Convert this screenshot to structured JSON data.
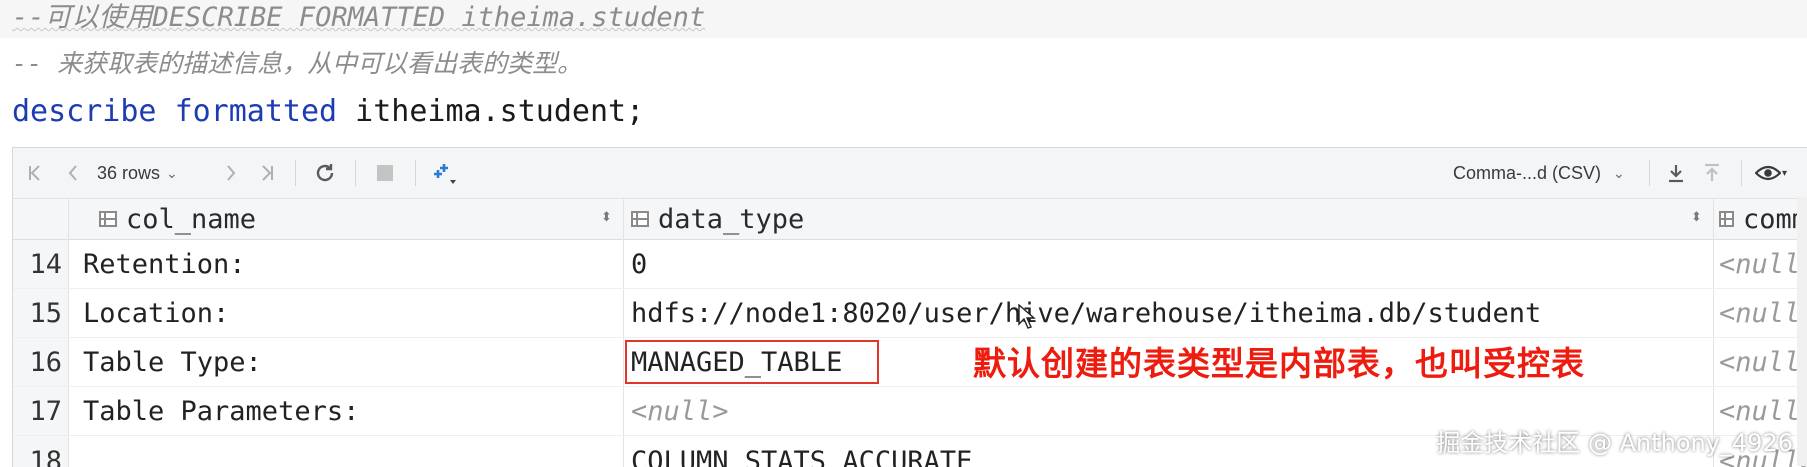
{
  "editor": {
    "line1_comment": "--可以使用DESCRIBE FORMATTED itheima.student",
    "line2_comment": "-- 来获取表的描述信息，从中可以看出表的类型。",
    "line3_kw1": "describe",
    "line3_kw2": "formatted",
    "line3_rest": " itheima.student;"
  },
  "toolbar": {
    "rows_label": "36 rows",
    "export_format": "Comma-...d (CSV)",
    "icons": [
      "first-page-icon",
      "prev-page-icon",
      "next-page-icon",
      "last-page-icon",
      "refresh-icon",
      "stop-icon",
      "pin-tool-icon",
      "download-icon",
      "upload-icon",
      "eye-icon"
    ]
  },
  "columns": [
    "col_name",
    "data_type",
    "comm"
  ],
  "rows": [
    {
      "num": "14",
      "col_name": "Retention:",
      "data_type": "0",
      "comment": "<null>"
    },
    {
      "num": "15",
      "col_name": "Location:",
      "data_type": "hdfs://node1:8020/user/hive/warehouse/itheima.db/student",
      "comment": "<null>"
    },
    {
      "num": "16",
      "col_name": "Table Type:",
      "data_type": "MANAGED_TABLE",
      "comment": "<null>"
    },
    {
      "num": "17",
      "col_name": "Table Parameters:",
      "data_type": "<null>",
      "comment": "<null>"
    },
    {
      "num": "18",
      "col_name": "",
      "data_type": "COLUMN_STATS_ACCURATE",
      "comment": "<null>"
    }
  ],
  "annotation": "默认创建的表类型是内部表，也叫受控表",
  "watermark": "掘金技术社区 @ Anthony_4926",
  "colors": {
    "keyword": "#1d3cb4",
    "comment": "#8c8c8c",
    "annotation": "#ee1c0e",
    "highlight_box": "#e0362c"
  }
}
